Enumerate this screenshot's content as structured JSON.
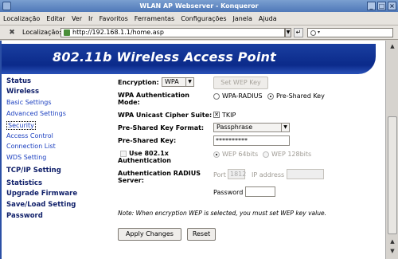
{
  "window": {
    "title": "WLAN AP Webserver - Konqueror"
  },
  "menu": [
    "Localização",
    "Editar",
    "Ver",
    "Ir",
    "Favoritos",
    "Ferramentas",
    "Configurações",
    "Janela",
    "Ajuda"
  ],
  "location": {
    "label": "Localização:",
    "url": "http://192.168.1.1/home.asp"
  },
  "banner": {
    "title": "802.11b Wireless Access Point"
  },
  "sidebar": {
    "status": "Status",
    "wireless": "Wireless",
    "basic": "Basic Settings",
    "advanced": "Advanced Settings",
    "security": "Security",
    "access": "Access Control",
    "connection": "Connection List",
    "wds": "WDS Setting",
    "tcpip": "TCP/IP Setting",
    "statistics": "Statistics",
    "upgrade": "Upgrade Firmware",
    "saveload": "Save/Load Setting",
    "password": "Password"
  },
  "form": {
    "encryption_label": "Encryption:",
    "encryption_value": "WPA",
    "set_wep_key": "Set WEP Key",
    "auth_mode_label": "WPA Authentication Mode:",
    "auth_radius": "WPA-RADIUS",
    "auth_psk": "Pre-Shared Key",
    "cipher_label": "WPA Unicast Cipher Suite:",
    "cipher_tkip": "TKIP",
    "psk_format_label": "Pre-Shared Key Format:",
    "psk_format_value": "Passphrase",
    "psk_label": "Pre-Shared Key:",
    "psk_value": "**********",
    "use_8021x_label": "Use 802.1x Authentication",
    "wep64": "WEP 64bits",
    "wep128": "WEP 128bits",
    "radius_label": "Authentication RADIUS Server:",
    "port_label": "Port",
    "port_value": "1812",
    "ip_label": "IP address",
    "password_label": "Password",
    "note": "Note: When encryption WEP is selected, you must set WEP key value.",
    "apply": "Apply Changes",
    "reset": "Reset"
  }
}
